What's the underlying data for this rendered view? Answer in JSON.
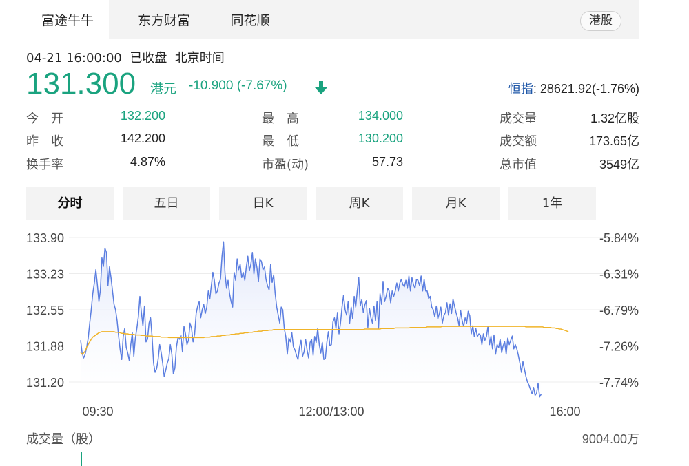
{
  "tabs": [
    {
      "label": "富途牛牛",
      "active": true
    },
    {
      "label": "东方财富",
      "active": false
    },
    {
      "label": "同花顺",
      "active": false
    }
  ],
  "market_badge": "港股",
  "header": {
    "timestamp": "04-21 16:00:00",
    "status": "已收盘",
    "timezone": "北京时间",
    "price": "131.300",
    "currency": "港元",
    "change": "-10.900 (-7.67%)",
    "index_label": "恒指",
    "index_value": ": 28621.92(-1.76%)",
    "down_color": "#1aa37f"
  },
  "stats": {
    "open_label": "今　开",
    "open_value": "132.200",
    "prev_close_label": "昨　收",
    "prev_close_value": "142.200",
    "turnover_rate_label": "换手率",
    "turnover_rate_value": "4.87%",
    "high_label": "最　高",
    "high_value": "134.000",
    "low_label": "最　低",
    "low_value": "130.200",
    "pe_label": "市盈(动)",
    "pe_value": "57.73",
    "volume_label": "成交量",
    "volume_value": "1.32亿股",
    "amount_label": "成交额",
    "amount_value": "173.65亿",
    "mktcap_label": "总市值",
    "mktcap_value": "3549亿"
  },
  "periods": [
    {
      "label": "分时",
      "active": true
    },
    {
      "label": "五日",
      "active": false
    },
    {
      "label": "日K",
      "active": false
    },
    {
      "label": "周K",
      "active": false
    },
    {
      "label": "月K",
      "active": false
    },
    {
      "label": "1年",
      "active": false
    }
  ],
  "volume": {
    "label": "成交量（股）",
    "max": "9004.00万"
  },
  "chart_data": {
    "type": "line",
    "y_ticks": [
      "133.90",
      "133.23",
      "132.55",
      "131.88",
      "131.20"
    ],
    "pct_ticks": [
      "-5.84%",
      "-6.31%",
      "-6.79%",
      "-7.26%",
      "-7.74%"
    ],
    "x_ticks": [
      "09:30",
      "12:00/13:00",
      "16:00"
    ],
    "ylim": [
      130.9,
      134.2
    ],
    "x_range": [
      0,
      330
    ],
    "colors": {
      "price": "#5b7ee0",
      "price_fill": "#dfe6fa",
      "avg": "#f0b429",
      "grid": "#ececec"
    },
    "series": [
      {
        "values": [
          131.98,
          131.74,
          131.65,
          131.72,
          131.85,
          132.02,
          132.3,
          132.55,
          132.85,
          133.05,
          133.3,
          133.02,
          132.7,
          132.92,
          133.52,
          133.36,
          133.7,
          133.62,
          133.0,
          133.35,
          133.15,
          132.9,
          132.65,
          132.55,
          132.35,
          132.05,
          131.8,
          131.62,
          132.05,
          132.2,
          131.85,
          131.74,
          131.6,
          131.9,
          132.12,
          131.68,
          132.02,
          132.2,
          132.42,
          132.8,
          132.5,
          132.25,
          132.62,
          131.95,
          132.0,
          132.3,
          132.4,
          132.05,
          131.55,
          131.38,
          131.45,
          131.62,
          131.9,
          131.75,
          131.55,
          131.3,
          131.42,
          131.55,
          131.64,
          131.9,
          131.72,
          131.35,
          131.46,
          131.85,
          132.02,
          132.0,
          132.08,
          131.76,
          132.24,
          132.1,
          131.9,
          131.98,
          132.3,
          132.2,
          131.95,
          132.1,
          132.48,
          132.62,
          132.7,
          132.4,
          132.55,
          132.65,
          132.48,
          132.6,
          132.9,
          132.75,
          133.0,
          133.25,
          133.1,
          132.85,
          132.9,
          133.05,
          133.12,
          133.55,
          133.82,
          133.22,
          132.95,
          133.1,
          132.85,
          132.7,
          132.6,
          133.25,
          133.1,
          133.5,
          133.3,
          133.4,
          133.15,
          133.25,
          133.1,
          133.35,
          133.55,
          133.28,
          133.4,
          133.62,
          133.22,
          133.5,
          133.34,
          133.08,
          133.5,
          133.45,
          133.3,
          133.35,
          133.12,
          133.0,
          132.92,
          133.4,
          133.06,
          133.2,
          132.85,
          132.6,
          132.45,
          132.3,
          132.6,
          132.55,
          132.2,
          132.05,
          131.72,
          132.02,
          131.95,
          132.12,
          131.86,
          131.8,
          131.7,
          131.62,
          131.85,
          131.98,
          131.68,
          131.76,
          132.0,
          131.8,
          131.65,
          131.94,
          132.0,
          131.7,
          132.05,
          131.94,
          132.2,
          131.9,
          131.74,
          131.94,
          131.62,
          131.64,
          131.94,
          132.14,
          131.88,
          131.9,
          132.32,
          132.4,
          132.2,
          132.5,
          132.1,
          132.3,
          132.6,
          132.82,
          132.55,
          132.45,
          132.7,
          132.3,
          132.6,
          132.38,
          132.8,
          132.6,
          132.9,
          133.15,
          132.62,
          132.74,
          132.5,
          132.64,
          132.72,
          132.22,
          132.58,
          132.4,
          132.3,
          132.62,
          132.35,
          132.7,
          132.2,
          132.85,
          132.65,
          133.08,
          132.7,
          132.8,
          132.95,
          132.9,
          132.68,
          132.9,
          132.8,
          132.9,
          133.05,
          132.9,
          133.05,
          133.12,
          133.02,
          132.98,
          133.1,
          132.95,
          133.18,
          132.9,
          133.15,
          133.02,
          132.95,
          133.12,
          133.1,
          133.0,
          133.18,
          132.9,
          133.12,
          132.9,
          132.9,
          132.76,
          132.8,
          132.6,
          132.55,
          132.42,
          132.62,
          132.38,
          132.48,
          132.6,
          132.3,
          132.44,
          132.5,
          132.68,
          132.45,
          132.66,
          132.48,
          132.75,
          132.62,
          132.5,
          132.4,
          132.25,
          132.54,
          132.35,
          132.24,
          132.4,
          132.3,
          132.52,
          132.44,
          132.1,
          132.25,
          132.05,
          132.2,
          132.05,
          132.1,
          132.08,
          131.9,
          132.1,
          131.98,
          132.05,
          132.24,
          131.9,
          132.06,
          131.82,
          132.08,
          131.72,
          131.9,
          131.84,
          132.0,
          131.75,
          131.88,
          131.95,
          131.72,
          132.02,
          131.9,
          131.98,
          132.06,
          131.82,
          131.9,
          131.82,
          131.7,
          131.55,
          131.38,
          131.58,
          131.44,
          131.3,
          131.2,
          131.14,
          131.06,
          130.98,
          131.1,
          130.95,
          130.99,
          131.18,
          130.92,
          130.97
        ]
      },
      {
        "values": [
          131.75,
          131.72,
          131.74,
          131.78,
          131.85,
          131.9,
          131.95,
          132.0,
          132.04,
          132.06,
          132.08,
          132.1,
          132.12,
          132.13,
          132.14,
          132.14,
          132.14,
          132.14,
          132.14,
          132.14,
          132.14,
          132.14,
          132.14,
          132.13,
          132.13,
          132.13,
          132.12,
          132.11,
          132.11,
          132.1,
          132.1,
          132.1,
          132.09,
          132.09,
          132.09,
          132.09,
          132.08,
          132.08,
          132.08,
          132.08,
          132.07,
          132.07,
          132.07,
          132.06,
          132.06,
          132.06,
          132.06,
          132.06,
          132.05,
          132.05,
          132.05,
          132.05,
          132.05,
          132.04,
          132.04,
          132.04,
          132.04,
          132.04,
          132.03,
          132.03,
          132.03,
          132.03,
          132.03,
          132.03,
          132.03,
          132.03,
          132.03,
          132.03,
          132.03,
          132.03,
          132.03,
          132.03,
          132.03,
          132.03,
          132.03,
          132.03,
          132.03,
          132.03,
          132.03,
          132.03,
          132.03,
          132.03,
          132.04,
          132.04,
          132.04,
          132.04,
          132.05,
          132.05,
          132.05,
          132.05,
          132.06,
          132.06,
          132.06,
          132.07,
          132.07,
          132.07,
          132.08,
          132.08,
          132.08,
          132.09,
          132.09,
          132.09,
          132.1,
          132.1,
          132.1,
          132.11,
          132.11,
          132.11,
          132.12,
          132.12,
          132.12,
          132.13,
          132.13,
          132.13,
          132.14,
          132.14,
          132.14,
          132.15,
          132.15,
          132.15,
          132.16,
          132.16,
          132.16,
          132.16,
          132.17,
          132.17,
          132.17,
          132.18,
          132.18,
          132.18,
          132.18,
          132.18,
          132.18,
          132.18,
          132.18,
          132.18,
          132.18,
          132.18,
          132.18,
          132.18,
          132.18,
          132.18,
          132.18,
          132.18,
          132.18,
          132.18,
          132.18,
          132.18,
          132.18,
          132.18,
          132.18,
          132.18,
          132.18,
          132.18,
          132.18,
          132.18,
          132.18,
          132.18,
          132.18,
          132.18,
          132.18,
          132.18,
          132.18,
          132.18,
          132.18,
          132.18,
          132.18,
          132.18,
          132.18,
          132.18,
          132.18,
          132.18,
          132.18,
          132.18,
          132.18,
          132.18,
          132.18,
          132.18,
          132.18,
          132.18,
          132.18,
          132.18,
          132.18,
          132.18,
          132.18,
          132.18,
          132.18,
          132.19,
          132.19,
          132.19,
          132.19,
          132.19,
          132.19,
          132.19,
          132.19,
          132.19,
          132.19,
          132.19,
          132.2,
          132.2,
          132.2,
          132.2,
          132.2,
          132.2,
          132.2,
          132.2,
          132.2,
          132.21,
          132.21,
          132.21,
          132.21,
          132.21,
          132.21,
          132.21,
          132.21,
          132.21,
          132.21,
          132.22,
          132.22,
          132.22,
          132.22,
          132.22,
          132.22,
          132.22,
          132.22,
          132.22,
          132.22,
          132.22,
          132.23,
          132.23,
          132.23,
          132.23,
          132.23,
          132.23,
          132.23,
          132.23,
          132.23,
          132.23,
          132.24,
          132.24,
          132.24,
          132.24,
          132.24,
          132.24,
          132.24,
          132.24,
          132.24,
          132.24,
          132.24,
          132.24,
          132.24,
          132.24,
          132.24,
          132.24,
          132.24,
          132.24,
          132.24,
          132.24,
          132.24,
          132.24,
          132.24,
          132.24,
          132.24,
          132.24,
          132.24,
          132.24,
          132.24,
          132.24,
          132.24,
          132.24,
          132.24,
          132.24,
          132.24,
          132.24,
          132.24,
          132.24,
          132.24,
          132.24,
          132.24,
          132.24,
          132.24,
          132.24,
          132.24,
          132.24,
          132.24,
          132.24,
          132.24,
          132.24,
          132.24,
          132.24,
          132.24,
          132.24,
          132.24,
          132.23,
          132.23,
          132.23,
          132.23,
          132.23,
          132.23,
          132.23,
          132.23,
          132.23,
          132.23,
          132.23,
          132.23,
          132.22,
          132.22,
          132.22,
          132.22,
          132.22,
          132.21,
          132.21,
          132.21,
          132.2,
          132.2,
          132.19,
          132.19,
          132.18,
          132.17,
          132.16,
          132.15,
          132.14
        ]
      }
    ]
  }
}
